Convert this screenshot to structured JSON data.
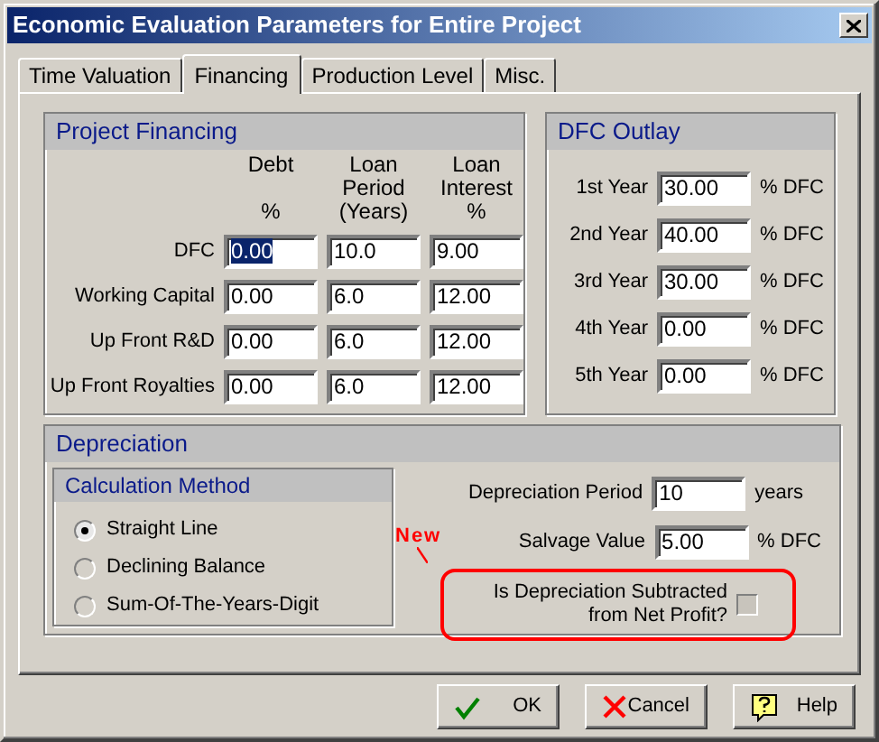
{
  "window": {
    "title": "Economic Evaluation Parameters for Entire Project"
  },
  "tabs": [
    {
      "label": "Time Valuation",
      "selected": false
    },
    {
      "label": "Financing",
      "selected": true
    },
    {
      "label": "Production Level",
      "selected": false
    },
    {
      "label": "Misc.",
      "selected": false
    }
  ],
  "project_financing": {
    "title": "Project Financing",
    "columns": [
      "Debt\n\n%",
      "Loan\nPeriod\n(Years)",
      "Loan\nInterest\n%"
    ],
    "rows": [
      {
        "label": "DFC",
        "cells": [
          {
            "value": "0.00",
            "selected": true
          },
          {
            "value": "10.0",
            "selected": false
          },
          {
            "value": "9.00",
            "selected": false
          }
        ]
      },
      {
        "label": "Working Capital",
        "cells": [
          {
            "value": "0.00",
            "selected": false
          },
          {
            "value": "6.0",
            "selected": false
          },
          {
            "value": "12.00",
            "selected": false
          }
        ]
      },
      {
        "label": "Up Front R&D",
        "cells": [
          {
            "value": "0.00",
            "selected": false
          },
          {
            "value": "6.0",
            "selected": false
          },
          {
            "value": "12.00",
            "selected": false
          }
        ]
      },
      {
        "label": "Up Front Royalties",
        "cells": [
          {
            "value": "0.00",
            "selected": false
          },
          {
            "value": "6.0",
            "selected": false
          },
          {
            "value": "12.00",
            "selected": false
          }
        ]
      }
    ]
  },
  "dfc_outlay": {
    "title": "DFC Outlay",
    "rows": [
      {
        "label": "1st Year",
        "value": "30.00",
        "unit": "% DFC"
      },
      {
        "label": "2nd Year",
        "value": "40.00",
        "unit": "% DFC"
      },
      {
        "label": "3rd Year",
        "value": "30.00",
        "unit": "% DFC"
      },
      {
        "label": "4th Year",
        "value": "0.00",
        "unit": "% DFC"
      },
      {
        "label": "5th Year",
        "value": "0.00",
        "unit": "% DFC"
      }
    ]
  },
  "depreciation": {
    "title": "Depreciation",
    "calculation_method": {
      "title": "Calculation Method",
      "options": [
        {
          "label": "Straight Line",
          "selected": true
        },
        {
          "label": "Declining Balance",
          "selected": false
        },
        {
          "label": "Sum-Of-The-Years-Digit",
          "selected": false
        }
      ]
    },
    "fields": [
      {
        "label": "Depreciation Period",
        "value": "10",
        "unit": "years"
      },
      {
        "label": "Salvage Value",
        "value": "5.00",
        "unit": "% DFC"
      }
    ],
    "annotation": "New",
    "subtract_option": {
      "label": "Is Depreciation Subtracted\nfrom Net Profit?",
      "checked": false
    }
  },
  "buttons": [
    {
      "label": "OK",
      "kind": "ok"
    },
    {
      "label": "Cancel",
      "kind": "cancel"
    },
    {
      "label": "Help",
      "kind": "help"
    }
  ]
}
